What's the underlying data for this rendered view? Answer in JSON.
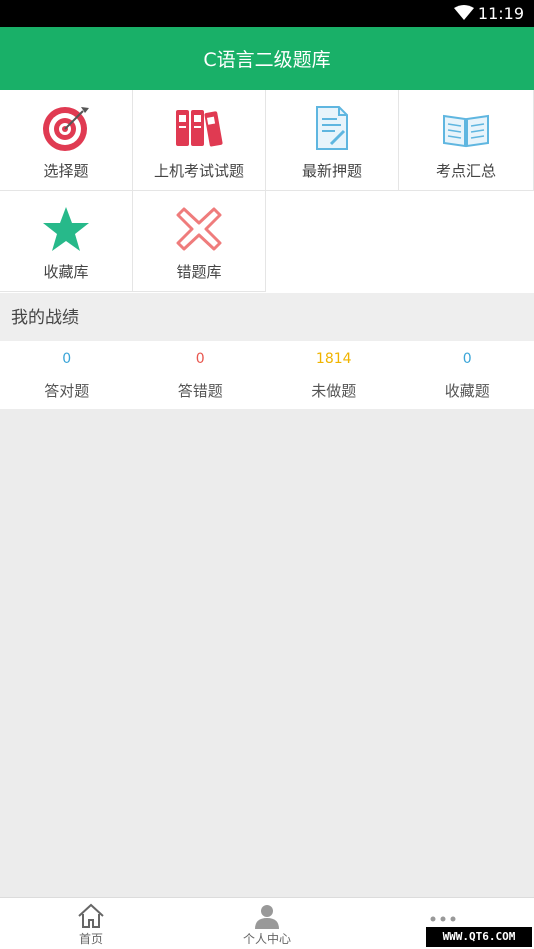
{
  "status_bar": {
    "time": "11:19",
    "wifi_icon": "wifi-icon"
  },
  "header": {
    "title": "C语言二级题库"
  },
  "menu": [
    {
      "label": "选择题",
      "icon": "target-icon"
    },
    {
      "label": "上机考试试题",
      "icon": "binders-icon"
    },
    {
      "label": "最新押题",
      "icon": "document-edit-icon"
    },
    {
      "label": "考点汇总",
      "icon": "open-book-icon"
    },
    {
      "label": "收藏库",
      "icon": "star-icon"
    },
    {
      "label": "错题库",
      "icon": "x-mark-icon"
    }
  ],
  "stats_section": {
    "title": "我的战绩",
    "items": [
      {
        "value": "0",
        "label": "答对题",
        "color": "#3aa5d8"
      },
      {
        "value": "0",
        "label": "答错题",
        "color": "#e8564e"
      },
      {
        "value": "1814",
        "label": "未做题",
        "color": "#f0b400"
      },
      {
        "value": "0",
        "label": "收藏题",
        "color": "#3aa5d8"
      }
    ]
  },
  "bottom_nav": [
    {
      "label": "首页",
      "icon": "home-icon"
    },
    {
      "label": "个人中心",
      "icon": "person-icon"
    },
    {
      "label": "",
      "icon": "more-dots-icon"
    }
  ],
  "watermark": "WWW.QT6.COM",
  "colors": {
    "brand": "#19b068",
    "icon_red": "#e03a52",
    "icon_blue": "#5fb6e0",
    "icon_green": "#27b98a",
    "icon_pink": "#ef7c7c"
  }
}
